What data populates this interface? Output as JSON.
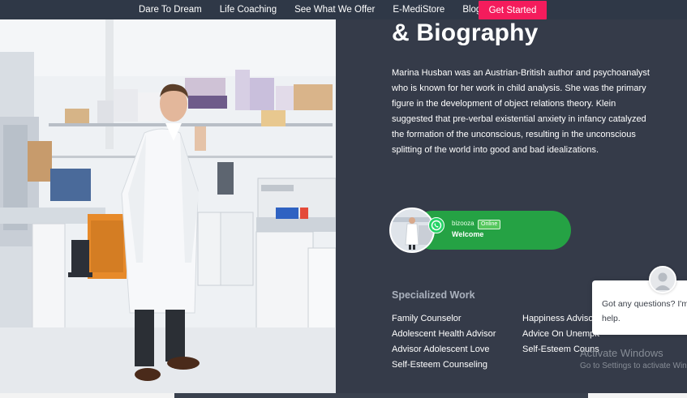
{
  "nav": {
    "links": [
      "Dare To Dream",
      "Life Coaching",
      "See What We Offer",
      "E-MediStore",
      "Blog"
    ],
    "cta_label": "Get Started"
  },
  "bio": {
    "heading": "& Biography",
    "text": "Marina Husban was an Austrian-British author and psychoanalyst who is known for her work in child analysis. She was the primary figure in the development of object relations theory. Klein suggested that pre-verbal existential anxiety in infancy catalyzed the formation of the unconscious, resulting in the unconscious splitting of the world into good and bad idealizations."
  },
  "whatsapp": {
    "name": "bizooza",
    "status": "Online",
    "welcome": "Welcome"
  },
  "specialized": {
    "title": "Specialized Work",
    "col1": [
      "Family Counselor",
      "Adolescent Health Advisor",
      "Advisor Adolescent Love",
      "Self-Esteem Counseling"
    ],
    "col2": [
      "Happiness Advisor",
      "Advice On Unemployment",
      "Self-Esteem Counseling"
    ]
  },
  "chat": {
    "line1": "Got any questions? I'm",
    "line2": "help."
  },
  "watermark": {
    "title": "Activate Windows",
    "subtitle": "Go to Settings to activate Windows."
  },
  "colors": {
    "nav_bg": "#2f3847",
    "cta": "#f41c5c",
    "panel_bg": "#353b49",
    "whatsapp_green": "#25a244"
  }
}
